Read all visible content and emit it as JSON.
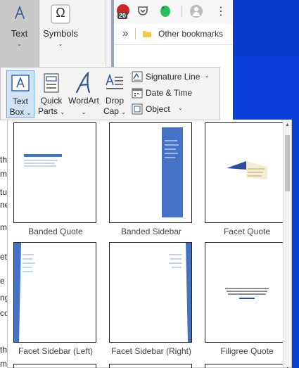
{
  "ribbon": {
    "text_label": "Text",
    "symbols_label": "Symbols",
    "symbols_glyph": "Ω",
    "caret": "⌄"
  },
  "browser": {
    "badge_count": "20",
    "more_glyph": "»",
    "other_bookmarks": "Other bookmarks",
    "menu_glyph": "⋮"
  },
  "dropdown": {
    "text_box_line1": "Text",
    "text_box_line2": "Box",
    "quick_parts_line1": "Quick",
    "quick_parts_line2": "Parts",
    "wordart": "WordArt",
    "drop_cap_line1": "Drop",
    "drop_cap_line2": "Cap",
    "signature_line": "Signature Line",
    "date_time": "Date & Time",
    "object": "Object"
  },
  "gallery": {
    "items": [
      {
        "label": "Banded Quote"
      },
      {
        "label": "Banded Sidebar"
      },
      {
        "label": "Facet Quote"
      },
      {
        "label": "Facet Sidebar (Left)"
      },
      {
        "label": "Facet Sidebar (Right)"
      },
      {
        "label": "Filigree Quote"
      }
    ]
  },
  "document": {
    "chars": [
      "th",
      "m",
      "tu",
      "ne",
      "m",
      "et",
      "e",
      "ng",
      "cc",
      "th",
      "m"
    ]
  },
  "colors": {
    "accent_blue": "#4472c4",
    "desktop_blue": "#0b3fd9",
    "selected_bg": "#cfe3f5"
  }
}
